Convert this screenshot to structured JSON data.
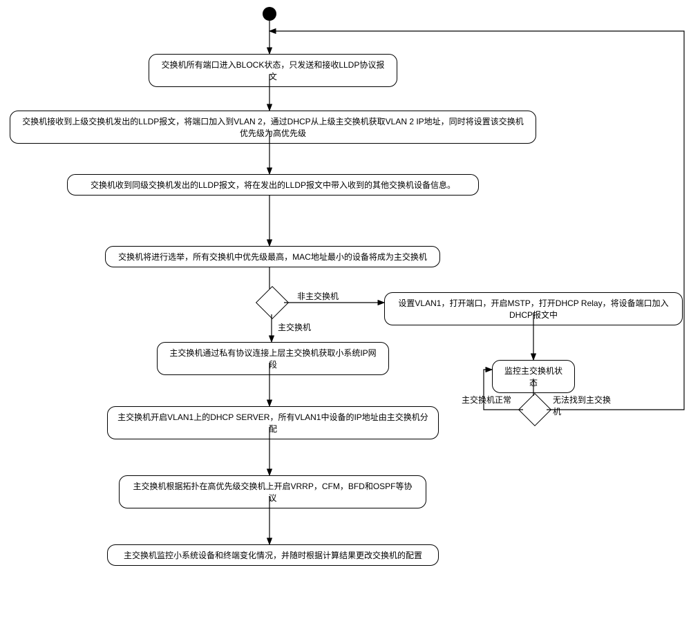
{
  "nodes": {
    "step1": "交换机所有端口进入BLOCK状态，只发送和接收LLDP协议报文",
    "step2": "交换机接收到上级交换机发出的LLDP报文，将端口加入到VLAN 2，通过DHCP从上级主交换机获取VLAN 2 IP地址，同时将设置该交换机优先级为高优先级",
    "step3": "交换机收到同级交换机发出的LLDP报文，将在发出的LLDP报文中带入收到的其他交换机设备信息。",
    "step4": "交换机将进行选举，所有交换机中优先级最高，MAC地址最小的设备将成为主交换机",
    "step5": "主交换机通过私有协议连接上层主交换机获取小系统IP网段",
    "step6": "主交换机开启VLAN1上的DHCP SERVER，所有VLAN1中设备的IP地址由主交换机分配",
    "step7": "主交换机根据拓扑在高优先级交换机上开启VRRP，CFM，BFD和OSPF等协议",
    "step8": "主交换机监控小系统设备和终端变化情况，并随时根据计算结果更改交换机的配置",
    "stepR1": "设置VLAN1，打开端口，开启MSTP，打开DHCP Relay，将设备端口加入DHCP报文中",
    "stepR2": "监控主交换机状态"
  },
  "labels": {
    "nonMaster": "非主交换机",
    "master": "主交换机",
    "masterOk": "主交换机正常",
    "noMaster": "无法找到主交换机"
  }
}
